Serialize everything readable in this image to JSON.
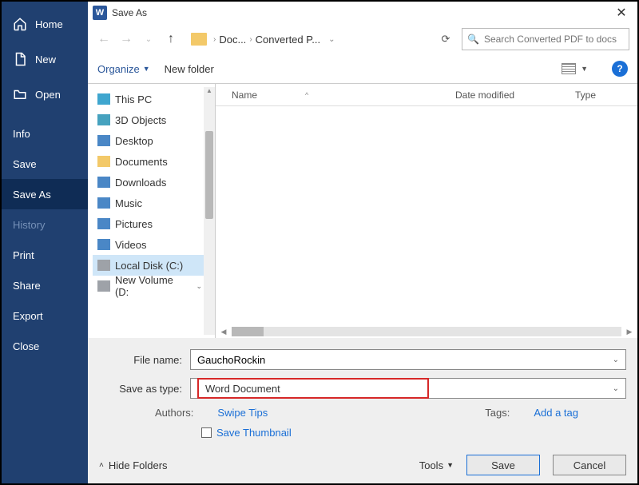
{
  "backstage": {
    "items": [
      {
        "label": "Home",
        "icon": "home-icon"
      },
      {
        "label": "New",
        "icon": "new-icon"
      },
      {
        "label": "Open",
        "icon": "open-icon"
      },
      {
        "label": "Info"
      },
      {
        "label": "Save"
      },
      {
        "label": "Save As",
        "selected": true
      },
      {
        "label": "History",
        "dim": true
      },
      {
        "label": "Print"
      },
      {
        "label": "Share"
      },
      {
        "label": "Export"
      },
      {
        "label": "Close"
      }
    ]
  },
  "dialog": {
    "title": "Save As",
    "nav": {
      "crumb1": "Doc...",
      "crumb2": "Converted P..."
    },
    "search": {
      "placeholder": "Search Converted PDF to docs"
    },
    "toolbar": {
      "organize": "Organize",
      "newfolder": "New folder"
    },
    "columns": {
      "name": "Name",
      "date": "Date modified",
      "type": "Type"
    },
    "tree": [
      {
        "label": "This PC",
        "cls": "pc"
      },
      {
        "label": "3D Objects",
        "cls": "d3"
      },
      {
        "label": "Desktop",
        "cls": "de"
      },
      {
        "label": "Documents",
        "cls": "dc"
      },
      {
        "label": "Downloads",
        "cls": "dl"
      },
      {
        "label": "Music",
        "cls": "mu"
      },
      {
        "label": "Pictures",
        "cls": "pi"
      },
      {
        "label": "Videos",
        "cls": "vi"
      },
      {
        "label": "Local Disk (C:)",
        "cls": "ld",
        "selected": true
      },
      {
        "label": "New Volume (D:",
        "cls": "nv"
      }
    ],
    "form": {
      "filename_label": "File name:",
      "filename_value": "GauchoRockin",
      "type_label": "Save as type:",
      "type_value": "Word Document",
      "authors_label": "Authors:",
      "authors_value": "Swipe Tips",
      "tags_label": "Tags:",
      "tags_value": "Add a tag",
      "thumb_label": "Save Thumbnail"
    },
    "footer": {
      "hide": "Hide Folders",
      "tools": "Tools",
      "save": "Save",
      "cancel": "Cancel"
    }
  }
}
